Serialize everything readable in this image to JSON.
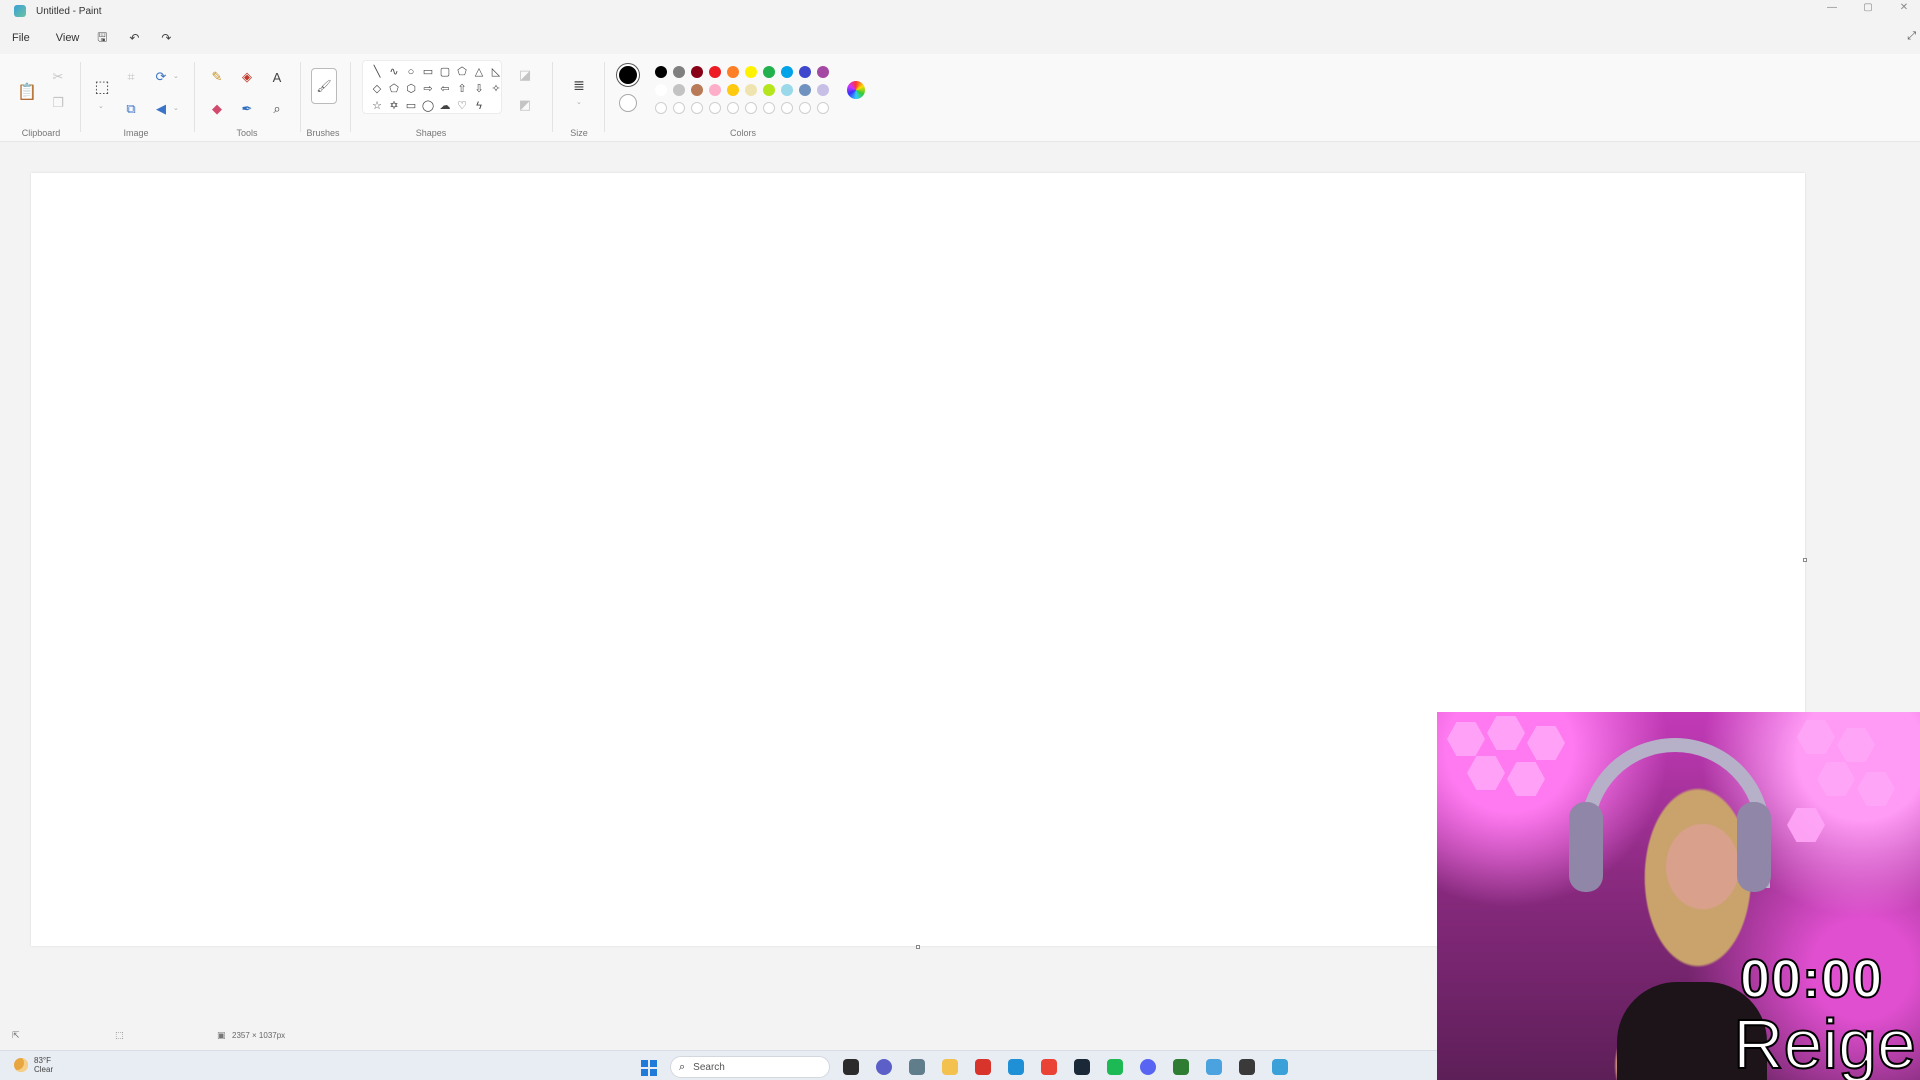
{
  "window": {
    "title": "Untitled - Paint"
  },
  "menu": {
    "file": "File",
    "view": "View"
  },
  "ribbon": {
    "groups": {
      "clipboard": "Clipboard",
      "image": "Image",
      "tools": "Tools",
      "brushes": "Brushes",
      "shapes": "Shapes",
      "size": "Size",
      "colors": "Colors"
    },
    "text_tool_glyph": "A"
  },
  "colors": {
    "primary": "#000000",
    "secondary": "#ffffff",
    "row1": [
      "#000000",
      "#7f7f7f",
      "#880015",
      "#ed1c24",
      "#ff7f27",
      "#fff200",
      "#22b14c",
      "#00a2e8",
      "#3f48cc",
      "#a349a4"
    ],
    "row2": [
      "#ffffff",
      "#c3c3c3",
      "#b97a57",
      "#ffaec9",
      "#ffc90e",
      "#efe4b0",
      "#b5e61d",
      "#99d9ea",
      "#7092be",
      "#c8bfe7"
    ]
  },
  "status": {
    "canvas_size": "2357 × 1037px"
  },
  "taskbar": {
    "weather_temp": "83°F",
    "weather_desc": "Clear",
    "search_placeholder": "Search",
    "app_colors": [
      "#2b2b2b",
      "#5b5fc7",
      "#607d8b",
      "#f2c14e",
      "#d9342b",
      "#1f8fd6",
      "#ea4335",
      "#1b2838",
      "#1db954",
      "#5865f2",
      "#2e7d32",
      "#4aa3df",
      "#3a3a3a",
      "#3aa0d8"
    ]
  },
  "webcam": {
    "timer": "00:00",
    "name": "Reige"
  }
}
